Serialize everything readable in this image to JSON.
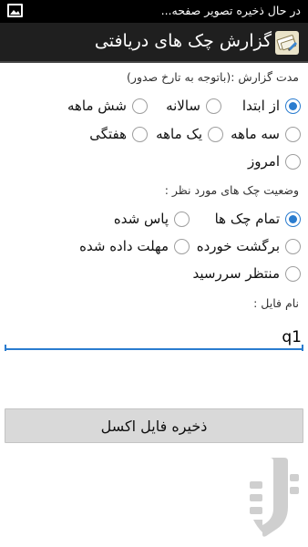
{
  "status_bar": {
    "text": "در حال ذخیره تصویر صفحه...",
    "icon": "gallery-icon"
  },
  "action_bar": {
    "title": "گزارش چک های دریافتی",
    "icon": "app-check-icon"
  },
  "report_period": {
    "label": "مدت گزارش :(باتوجه به تارخ صدور)",
    "options": [
      {
        "label": "از ابتدا",
        "checked": true
      },
      {
        "label": "سالانه",
        "checked": false
      },
      {
        "label": "شش ماهه",
        "checked": false
      },
      {
        "label": "سه ماهه",
        "checked": false
      },
      {
        "label": "یک ماهه",
        "checked": false
      },
      {
        "label": "هفتگی",
        "checked": false
      },
      {
        "label": "امروز",
        "checked": false
      }
    ]
  },
  "check_status": {
    "label": "وضعیت چک های مورد نظر :",
    "options": [
      {
        "label": "تمام چک ها",
        "checked": true
      },
      {
        "label": "پاس شده",
        "checked": false
      },
      {
        "label": "برگشت خورده",
        "checked": false
      },
      {
        "label": "مهلت داده شده",
        "checked": false
      },
      {
        "label": "منتظر سررسید",
        "checked": false
      }
    ]
  },
  "file_name": {
    "label": "نام فایل :",
    "value": "q1"
  },
  "save_button": {
    "label": "ذخیره فایل اکسل"
  },
  "colors": {
    "accent": "#2a7ccf",
    "action_bar": "#1f1f1f",
    "status_bar": "#000000",
    "button_bg": "#d9d9d9"
  }
}
